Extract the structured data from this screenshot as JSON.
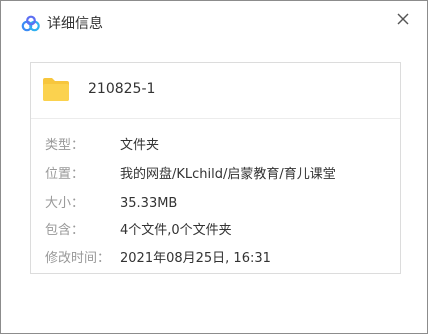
{
  "window": {
    "title": "详细信息",
    "app_icon": "baidu-netdisk-cloud-icon",
    "close_icon": "close-icon"
  },
  "file": {
    "icon": "folder-icon",
    "name": "210825-1"
  },
  "details": [
    {
      "label": "类型：",
      "value": "文件夹"
    },
    {
      "label": "位置：",
      "value": "我的网盘/KLchild/启蒙教育/育儿课堂"
    },
    {
      "label": "大小：",
      "value": "35.33MB"
    },
    {
      "label": "包含：",
      "value": "4个文件,0个文件夹"
    },
    {
      "label": "修改时间：",
      "value": "2021年08月25日, 16:31"
    }
  ],
  "colors": {
    "folder": "#f7c63d",
    "label": "#999999",
    "value": "#333333",
    "brand_blue": "#3b8cf5"
  }
}
